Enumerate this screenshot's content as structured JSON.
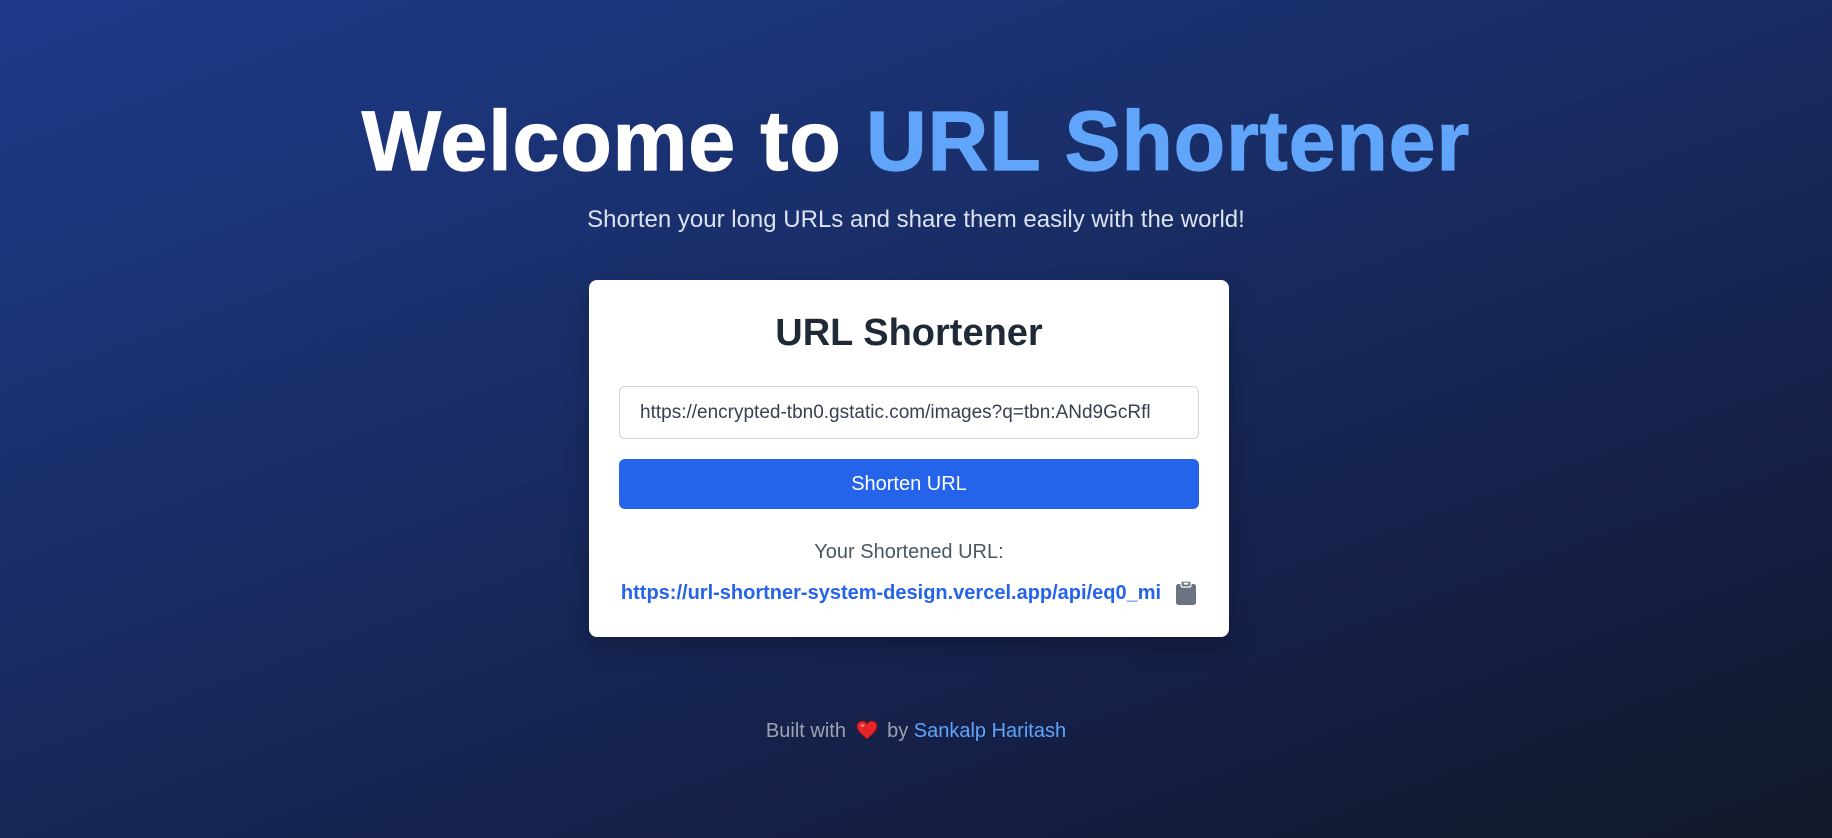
{
  "hero": {
    "title_prefix": "Welcome to ",
    "title_accent": "URL Shortener",
    "subtitle": "Shorten your long URLs and share them easily with the world!"
  },
  "card": {
    "title": "URL Shortener",
    "input_value": "https://encrypted-tbn0.gstatic.com/images?q=tbn:ANd9GcRfl",
    "button_label": "Shorten URL",
    "result_label": "Your Shortened URL:",
    "result_url": "https://url-shortner-system-design.vercel.app/api/eq0_mi",
    "copy_icon": "clipboard-icon"
  },
  "footer": {
    "built_with": "Built with",
    "heart_icon": "heart-icon",
    "by": "by",
    "author": "Sankalp Haritash"
  },
  "colors": {
    "accent": "#60a5fa",
    "button": "#2563eb",
    "link": "#2563eb"
  }
}
